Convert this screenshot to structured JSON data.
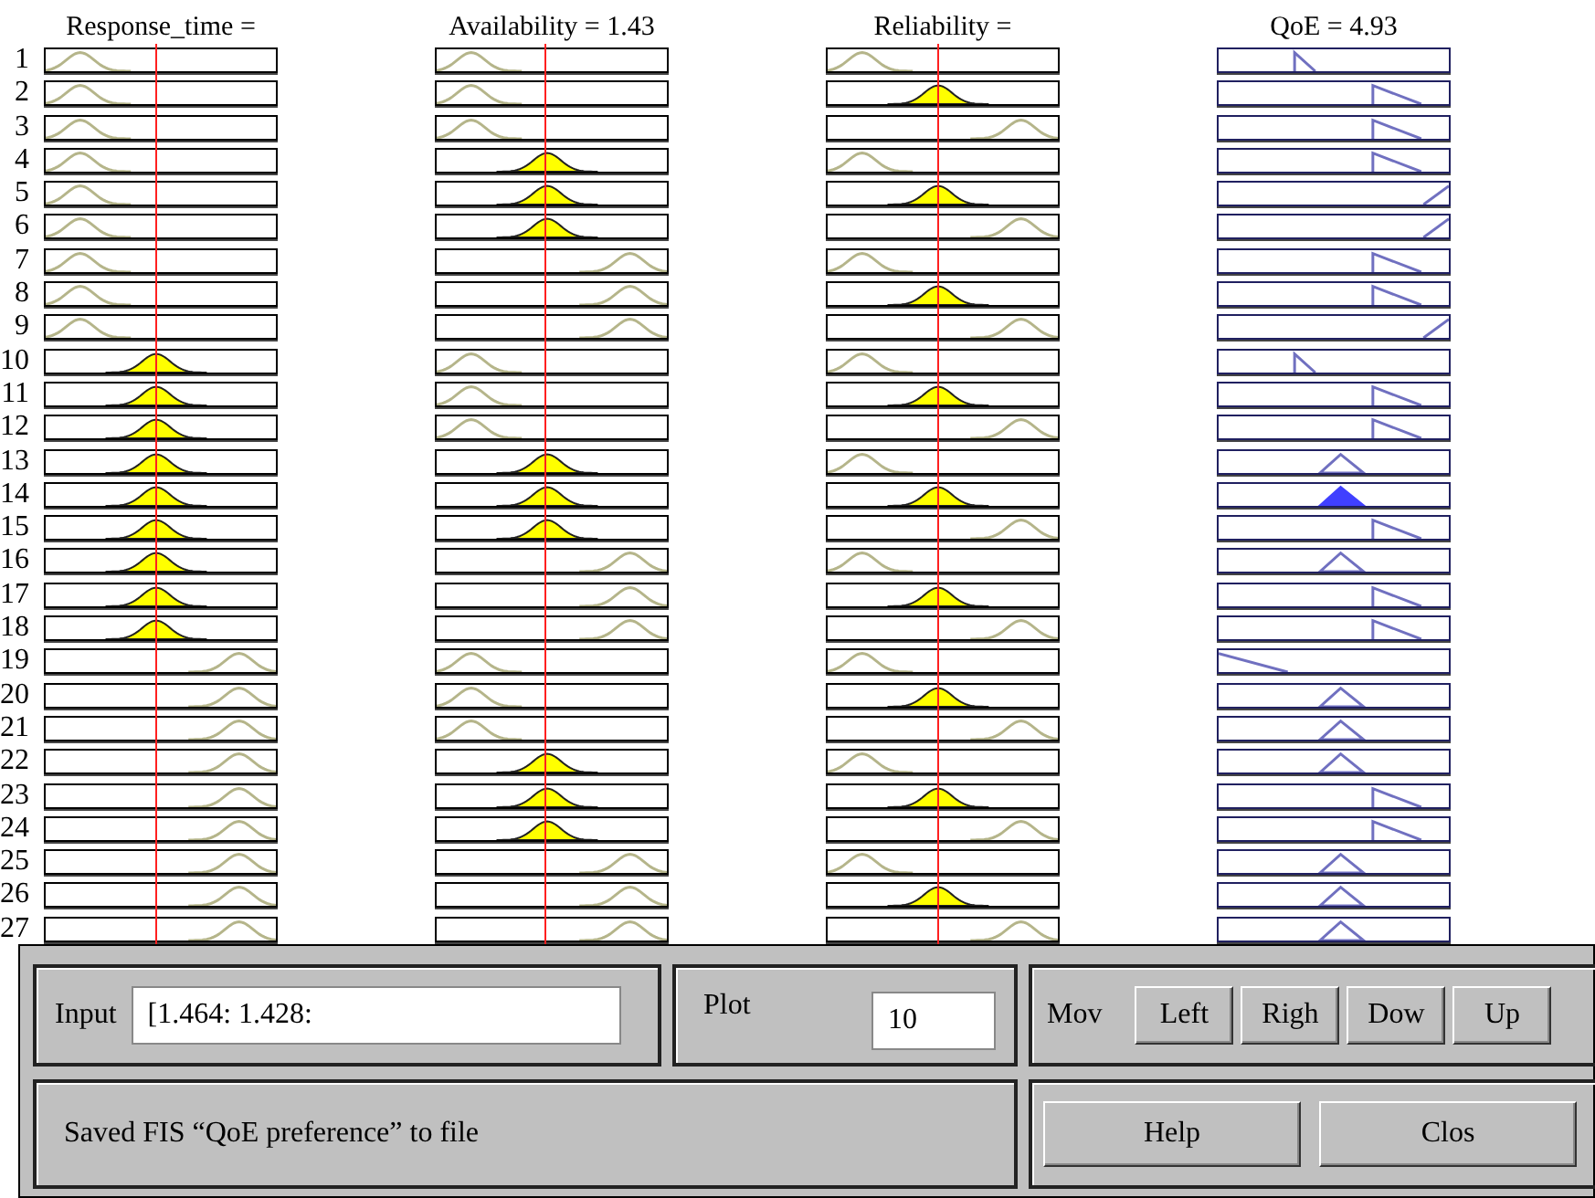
{
  "inputs": [
    {
      "label": "Response_time =",
      "level": 0.48
    },
    {
      "label": "Availability = 1.43",
      "level": 0.47
    },
    {
      "label": "Reliability =",
      "level": 0.48
    }
  ],
  "output": {
    "label": "QoE = 4.93"
  },
  "rules": [
    {
      "number": "1",
      "inputs": [
        {
          "kind": "low",
          "fired": false
        },
        {
          "kind": "low",
          "fired": false
        },
        {
          "kind": "low",
          "fired": false
        }
      ],
      "output": {
        "kind": "verylow",
        "fired": false
      }
    },
    {
      "number": "2",
      "inputs": [
        {
          "kind": "low",
          "fired": false
        },
        {
          "kind": "low",
          "fired": false
        },
        {
          "kind": "mid",
          "fired": true
        }
      ],
      "output": {
        "kind": "high",
        "fired": false
      }
    },
    {
      "number": "3",
      "inputs": [
        {
          "kind": "low",
          "fired": false
        },
        {
          "kind": "low",
          "fired": false
        },
        {
          "kind": "high",
          "fired": false
        }
      ],
      "output": {
        "kind": "high",
        "fired": false
      }
    },
    {
      "number": "4",
      "inputs": [
        {
          "kind": "low",
          "fired": false
        },
        {
          "kind": "mid",
          "fired": true
        },
        {
          "kind": "low",
          "fired": false
        }
      ],
      "output": {
        "kind": "high",
        "fired": false
      }
    },
    {
      "number": "5",
      "inputs": [
        {
          "kind": "low",
          "fired": false
        },
        {
          "kind": "mid",
          "fired": true
        },
        {
          "kind": "mid",
          "fired": true
        }
      ],
      "output": {
        "kind": "veryhigh",
        "fired": false
      }
    },
    {
      "number": "6",
      "inputs": [
        {
          "kind": "low",
          "fired": false
        },
        {
          "kind": "mid",
          "fired": true
        },
        {
          "kind": "high",
          "fired": false
        }
      ],
      "output": {
        "kind": "veryhigh",
        "fired": false
      }
    },
    {
      "number": "7",
      "inputs": [
        {
          "kind": "low",
          "fired": false
        },
        {
          "kind": "high",
          "fired": false
        },
        {
          "kind": "low",
          "fired": false
        }
      ],
      "output": {
        "kind": "high",
        "fired": false
      }
    },
    {
      "number": "8",
      "inputs": [
        {
          "kind": "low",
          "fired": false
        },
        {
          "kind": "high",
          "fired": false
        },
        {
          "kind": "mid",
          "fired": true
        }
      ],
      "output": {
        "kind": "high",
        "fired": false
      }
    },
    {
      "number": "9",
      "inputs": [
        {
          "kind": "low",
          "fired": false
        },
        {
          "kind": "high",
          "fired": false
        },
        {
          "kind": "high",
          "fired": false
        }
      ],
      "output": {
        "kind": "veryhigh",
        "fired": false
      }
    },
    {
      "number": "10",
      "inputs": [
        {
          "kind": "mid",
          "fired": true
        },
        {
          "kind": "low",
          "fired": false
        },
        {
          "kind": "low",
          "fired": false
        }
      ],
      "output": {
        "kind": "verylow",
        "fired": false
      }
    },
    {
      "number": "11",
      "inputs": [
        {
          "kind": "mid",
          "fired": true
        },
        {
          "kind": "low",
          "fired": false
        },
        {
          "kind": "mid",
          "fired": true
        }
      ],
      "output": {
        "kind": "high",
        "fired": false
      }
    },
    {
      "number": "12",
      "inputs": [
        {
          "kind": "mid",
          "fired": true
        },
        {
          "kind": "low",
          "fired": false
        },
        {
          "kind": "high",
          "fired": false
        }
      ],
      "output": {
        "kind": "high",
        "fired": false
      }
    },
    {
      "number": "13",
      "inputs": [
        {
          "kind": "mid",
          "fired": true
        },
        {
          "kind": "mid",
          "fired": true
        },
        {
          "kind": "low",
          "fired": false
        }
      ],
      "output": {
        "kind": "mid",
        "fired": false
      }
    },
    {
      "number": "14",
      "inputs": [
        {
          "kind": "mid",
          "fired": true
        },
        {
          "kind": "mid",
          "fired": true
        },
        {
          "kind": "mid",
          "fired": true
        }
      ],
      "output": {
        "kind": "mid",
        "fired": true
      }
    },
    {
      "number": "15",
      "inputs": [
        {
          "kind": "mid",
          "fired": true
        },
        {
          "kind": "mid",
          "fired": true
        },
        {
          "kind": "high",
          "fired": false
        }
      ],
      "output": {
        "kind": "high",
        "fired": false
      }
    },
    {
      "number": "16",
      "inputs": [
        {
          "kind": "mid",
          "fired": true
        },
        {
          "kind": "high",
          "fired": false
        },
        {
          "kind": "low",
          "fired": false
        }
      ],
      "output": {
        "kind": "mid",
        "fired": false
      }
    },
    {
      "number": "17",
      "inputs": [
        {
          "kind": "mid",
          "fired": true
        },
        {
          "kind": "high",
          "fired": false
        },
        {
          "kind": "mid",
          "fired": true
        }
      ],
      "output": {
        "kind": "high",
        "fired": false
      }
    },
    {
      "number": "18",
      "inputs": [
        {
          "kind": "mid",
          "fired": true
        },
        {
          "kind": "high",
          "fired": false
        },
        {
          "kind": "high",
          "fired": false
        }
      ],
      "output": {
        "kind": "high",
        "fired": false
      }
    },
    {
      "number": "19",
      "inputs": [
        {
          "kind": "high",
          "fired": false
        },
        {
          "kind": "low",
          "fired": false
        },
        {
          "kind": "low",
          "fired": false
        }
      ],
      "output": {
        "kind": "lowest",
        "fired": false
      }
    },
    {
      "number": "20",
      "inputs": [
        {
          "kind": "high",
          "fired": false
        },
        {
          "kind": "low",
          "fired": false
        },
        {
          "kind": "mid",
          "fired": true
        }
      ],
      "output": {
        "kind": "mid",
        "fired": false
      }
    },
    {
      "number": "21",
      "inputs": [
        {
          "kind": "high",
          "fired": false
        },
        {
          "kind": "low",
          "fired": false
        },
        {
          "kind": "high",
          "fired": false
        }
      ],
      "output": {
        "kind": "mid",
        "fired": false
      }
    },
    {
      "number": "22",
      "inputs": [
        {
          "kind": "high",
          "fired": false
        },
        {
          "kind": "mid",
          "fired": true
        },
        {
          "kind": "low",
          "fired": false
        }
      ],
      "output": {
        "kind": "mid",
        "fired": false
      }
    },
    {
      "number": "23",
      "inputs": [
        {
          "kind": "high",
          "fired": false
        },
        {
          "kind": "mid",
          "fired": true
        },
        {
          "kind": "mid",
          "fired": true
        }
      ],
      "output": {
        "kind": "high",
        "fired": false
      }
    },
    {
      "number": "24",
      "inputs": [
        {
          "kind": "high",
          "fired": false
        },
        {
          "kind": "mid",
          "fired": true
        },
        {
          "kind": "high",
          "fired": false
        }
      ],
      "output": {
        "kind": "high",
        "fired": false
      }
    },
    {
      "number": "25",
      "inputs": [
        {
          "kind": "high",
          "fired": false
        },
        {
          "kind": "high",
          "fired": false
        },
        {
          "kind": "low",
          "fired": false
        }
      ],
      "output": {
        "kind": "mid",
        "fired": false
      }
    },
    {
      "number": "26",
      "inputs": [
        {
          "kind": "high",
          "fired": false
        },
        {
          "kind": "high",
          "fired": false
        },
        {
          "kind": "mid",
          "fired": true
        }
      ],
      "output": {
        "kind": "mid",
        "fired": false
      }
    },
    {
      "number": "27",
      "inputs": [
        {
          "kind": "high",
          "fired": false
        },
        {
          "kind": "high",
          "fired": false
        },
        {
          "kind": "high",
          "fired": false
        }
      ],
      "output": {
        "kind": "mid",
        "fired": false
      }
    }
  ],
  "controls": {
    "input": {
      "label": "Input",
      "value": "[1.464: 1.428:"
    },
    "plot": {
      "label": "Plot",
      "value": "10"
    },
    "move": {
      "label": "Mov",
      "buttons": [
        "Left",
        "Righ",
        "Dow",
        "Up"
      ]
    },
    "status": "Saved FIS “QoE preference” to file",
    "buttons": [
      "Help",
      "Clos"
    ]
  }
}
